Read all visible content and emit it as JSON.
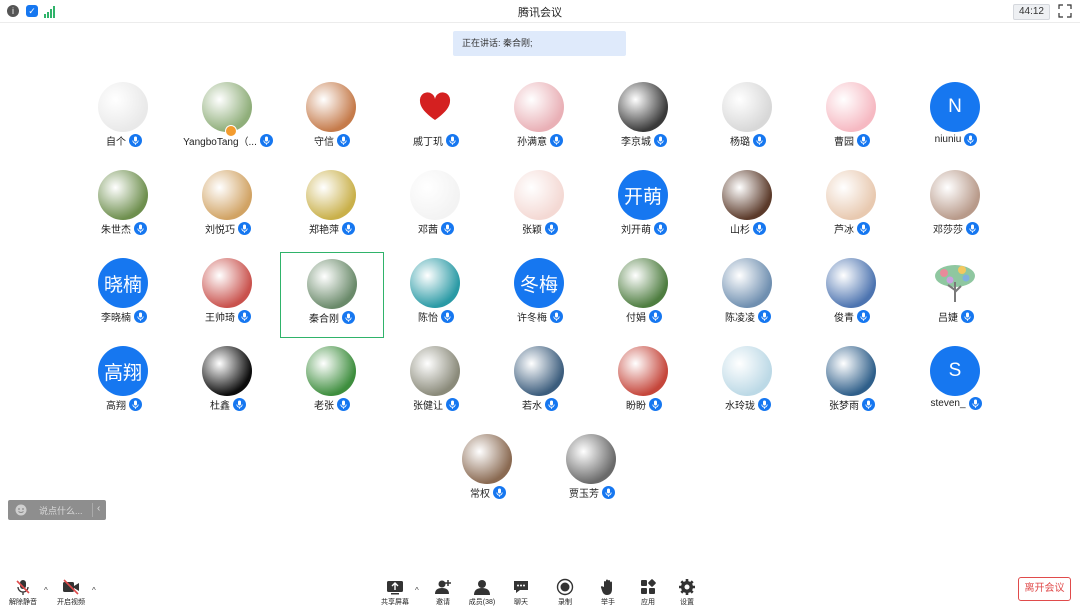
{
  "app": {
    "title": "腾讯会议",
    "timer": "44:12"
  },
  "speaking": {
    "text": "正在讲话: 秦合刚;"
  },
  "participants": [
    {
      "name": "自个",
      "avatar": "img",
      "color": "#e9e9e9",
      "row": 0,
      "col": 0
    },
    {
      "name": "YangboTang（...",
      "avatar": "img",
      "color": "#8fae7a",
      "row": 0,
      "col": 1,
      "badge": true
    },
    {
      "name": "守信",
      "avatar": "img",
      "color": "#c57b4b",
      "row": 0,
      "col": 2
    },
    {
      "name": "戚丁玑",
      "avatar": "heart",
      "color": "#ffffff",
      "row": 0,
      "col": 3
    },
    {
      "name": "孙满意",
      "avatar": "img",
      "color": "#e9b0b6",
      "row": 0,
      "col": 4
    },
    {
      "name": "李京城",
      "avatar": "img",
      "color": "#3a3a3a",
      "row": 0,
      "col": 5
    },
    {
      "name": "杨璐",
      "avatar": "img",
      "color": "#d8d8d8",
      "row": 0,
      "col": 6
    },
    {
      "name": "曹园",
      "avatar": "img",
      "color": "#f6b9c2",
      "row": 0,
      "col": 7
    },
    {
      "name": "niuniu",
      "avatar": "letter",
      "label": "N",
      "row": 0,
      "col": 8
    },
    {
      "name": "朱世杰",
      "avatar": "img",
      "color": "#6e8f4e",
      "row": 1,
      "col": 0
    },
    {
      "name": "刘悦巧",
      "avatar": "img",
      "color": "#d1a364",
      "row": 1,
      "col": 1
    },
    {
      "name": "郑艳萍",
      "avatar": "img",
      "color": "#c9b04a",
      "row": 1,
      "col": 2
    },
    {
      "name": "邓茜",
      "avatar": "img",
      "color": "#f3f3f3",
      "row": 1,
      "col": 3
    },
    {
      "name": "张颖",
      "avatar": "img",
      "color": "#f4d9d4",
      "row": 1,
      "col": 4
    },
    {
      "name": "刘开萌",
      "avatar": "text",
      "label": "开萌",
      "row": 1,
      "col": 5
    },
    {
      "name": "山杉",
      "avatar": "img",
      "color": "#5b3a2a",
      "row": 1,
      "col": 6
    },
    {
      "name": "芦冰",
      "avatar": "img",
      "color": "#e8c9b0",
      "row": 1,
      "col": 7
    },
    {
      "name": "邓莎莎",
      "avatar": "img",
      "color": "#b89a8a",
      "row": 1,
      "col": 8
    },
    {
      "name": "李晓楠",
      "avatar": "text",
      "label": "晓楠",
      "row": 2,
      "col": 0
    },
    {
      "name": "王帅琦",
      "avatar": "img",
      "color": "#c9524d",
      "row": 2,
      "col": 1
    },
    {
      "name": "秦合刚",
      "avatar": "img",
      "color": "#6a8a6a",
      "row": 2,
      "col": 2,
      "active": true
    },
    {
      "name": "陈怡",
      "avatar": "img",
      "color": "#2a9aa5",
      "row": 2,
      "col": 3
    },
    {
      "name": "许冬梅",
      "avatar": "text",
      "label": "冬梅",
      "row": 2,
      "col": 4
    },
    {
      "name": "付娟",
      "avatar": "img",
      "color": "#4e7d40",
      "row": 2,
      "col": 5
    },
    {
      "name": "陈凌凌",
      "avatar": "img",
      "color": "#6f8fb0",
      "row": 2,
      "col": 6
    },
    {
      "name": "俊青",
      "avatar": "img",
      "color": "#4d74b0",
      "row": 2,
      "col": 7
    },
    {
      "name": "吕婕",
      "avatar": "tree",
      "color": "#ffffff",
      "row": 2,
      "col": 8
    },
    {
      "name": "高翔",
      "avatar": "text",
      "label": "高翔",
      "row": 3,
      "col": 0
    },
    {
      "name": "杜鑫",
      "avatar": "img",
      "color": "#0c0c0c",
      "row": 3,
      "col": 1
    },
    {
      "name": "老张",
      "avatar": "img",
      "color": "#3e8e3e",
      "row": 3,
      "col": 2
    },
    {
      "name": "张健让",
      "avatar": "img",
      "color": "#8a8a7a",
      "row": 3,
      "col": 3
    },
    {
      "name": "若水",
      "avatar": "img",
      "color": "#3c5d7d",
      "row": 3,
      "col": 4
    },
    {
      "name": "盼盼",
      "avatar": "img",
      "color": "#c5463b",
      "row": 3,
      "col": 5
    },
    {
      "name": "水玲珑",
      "avatar": "img",
      "color": "#bcd9e6",
      "row": 3,
      "col": 6
    },
    {
      "name": "张梦雨",
      "avatar": "img",
      "color": "#2f5f8a",
      "row": 3,
      "col": 7
    },
    {
      "name": "steven_",
      "avatar": "letter",
      "label": "S",
      "row": 3,
      "col": 8
    },
    {
      "name": "常权",
      "avatar": "img",
      "color": "#8a6a52",
      "row": 4,
      "col": 0
    },
    {
      "name": "贾玉芳",
      "avatar": "img",
      "color": "#6a6a6a",
      "row": 4,
      "col": 1
    }
  ],
  "chat": {
    "placeholder": "说点什么..."
  },
  "toolbar": {
    "mute_label": "解除静音",
    "video_label": "开启视频",
    "share_label": "共享屏幕",
    "invite_label": "邀请",
    "members_label": "成员(38)",
    "chat_label": "聊天",
    "record_label": "录制",
    "raise_hand_label": "举手",
    "apps_label": "应用",
    "settings_label": "设置",
    "leave_label": "离开会议"
  },
  "colors": {
    "accent": "#1677f0",
    "active_border": "#2fb36a",
    "danger": "#e04b4b"
  }
}
